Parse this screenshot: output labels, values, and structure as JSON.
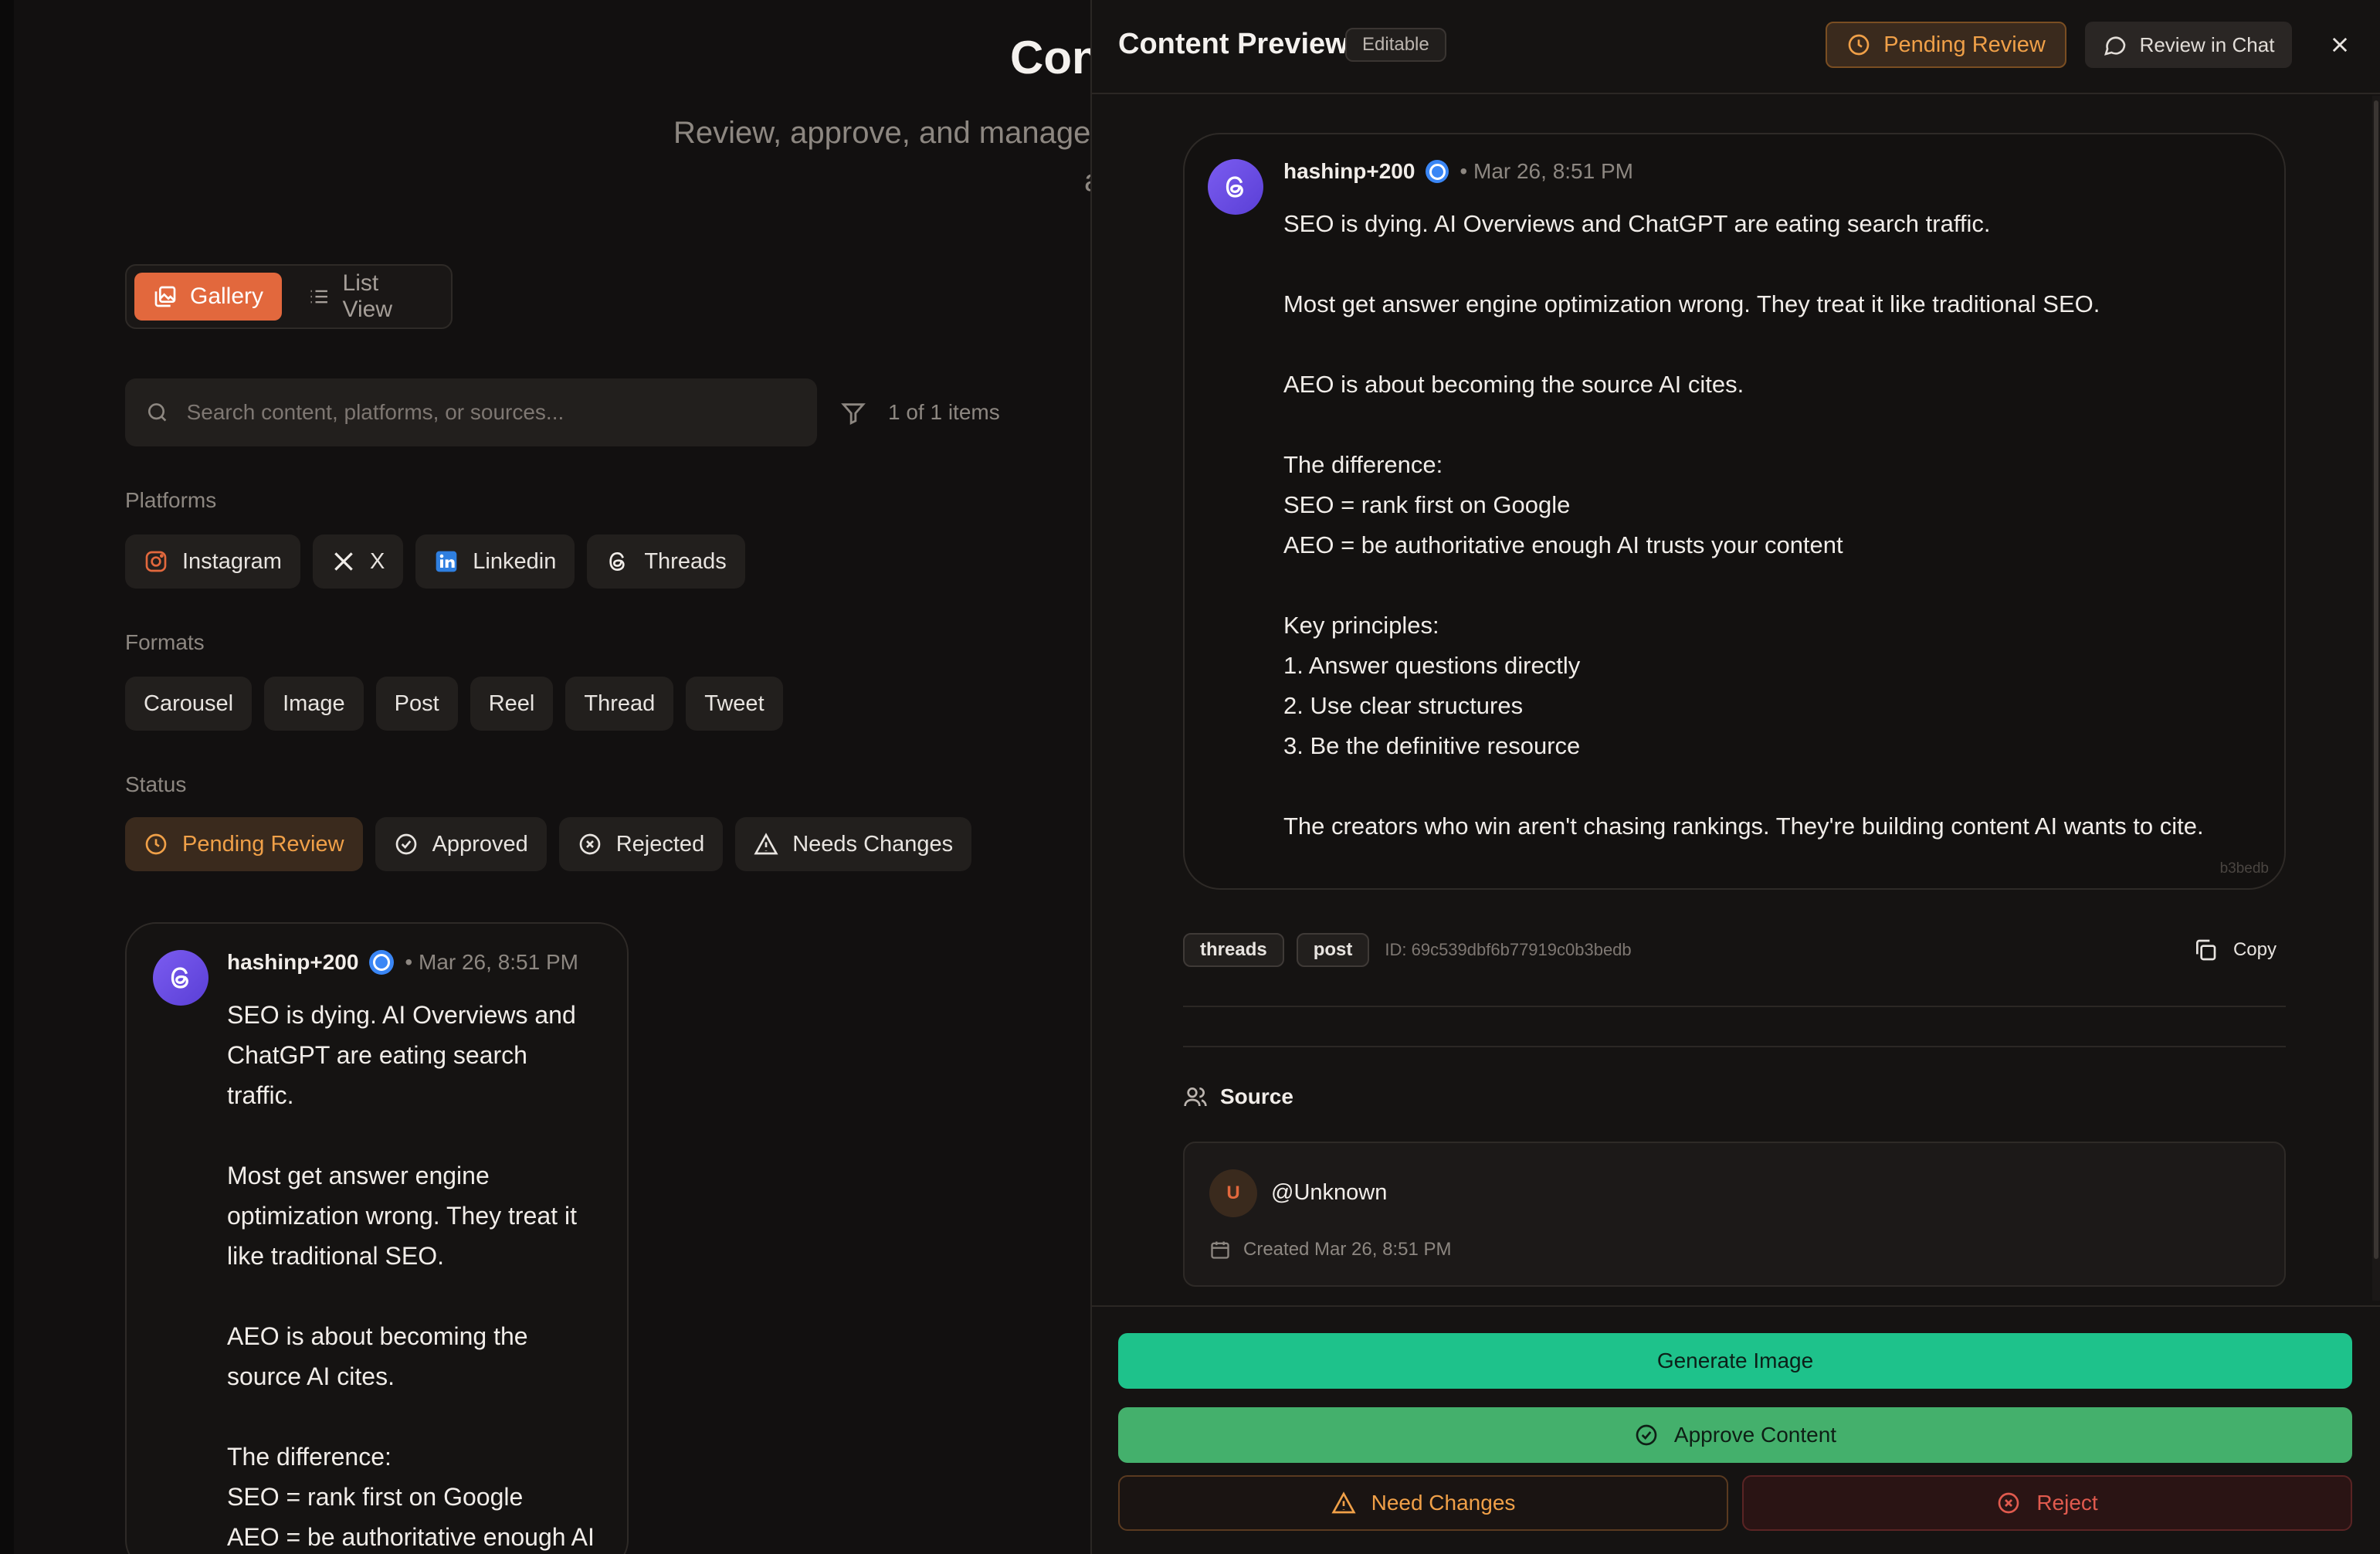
{
  "page": {
    "title": "Con",
    "subtitle": "Review, approve, and manage",
    "subtitle_cont": "a",
    "view_toggle": {
      "gallery": "Gallery",
      "list": "List View"
    },
    "search": {
      "placeholder": "Search content, platforms, or sources...",
      "value": ""
    },
    "item_count": "1 of 1 items",
    "platforms_label": "Platforms",
    "platforms": [
      "Instagram",
      "X",
      "Linkedin",
      "Threads"
    ],
    "formats_label": "Formats",
    "formats": [
      "Carousel",
      "Image",
      "Post",
      "Reel",
      "Thread",
      "Tweet"
    ],
    "status_label": "Status",
    "statuses": [
      "Pending Review",
      "Approved",
      "Rejected",
      "Needs Changes"
    ]
  },
  "post": {
    "username": "hashinp+200",
    "timestamp": "• Mar 26, 8:51 PM",
    "card_body": "SEO is dying. AI Overviews and\nChatGPT are eating search\ntraffic.\n\nMost get answer engine\noptimization wrong. They treat it\nlike traditional SEO.\n\nAEO is about becoming the\nsource AI cites.\n\nThe difference:\nSEO = rank first on Google\nAEO = be authoritative enough AI",
    "full_body": "SEO is dying. AI Overviews and ChatGPT are eating search traffic.\n\nMost get answer engine optimization wrong. They treat it like traditional SEO.\n\nAEO is about becoming the source AI cites.\n\nThe difference:\nSEO = rank first on Google\nAEO = be authoritative enough AI trusts your content\n\nKey principles:\n1. Answer questions directly\n2. Use clear structures\n3. Be the definitive resource\n\nThe creators who win aren't chasing rankings. They're building content AI wants to cite."
  },
  "drawer": {
    "title": "Content Preview",
    "editable_badge": "Editable",
    "status_button": "Pending Review",
    "chat_button": "Review in Chat",
    "card_tag": "b3bedb",
    "tags": [
      "threads",
      "post"
    ],
    "id_text": "ID: 69c539dbf6b77919c0b3bedb",
    "copy_label": "Copy",
    "source_heading": "Source",
    "source_avatar": "U",
    "source_handle": "@Unknown",
    "created": "Created Mar 26, 8:51 PM",
    "buttons": {
      "generate": "Generate Image",
      "approve": "Approve Content",
      "changes": "Need Changes",
      "reject": "Reject"
    }
  },
  "colors": {
    "accent": "#e2683d",
    "pending": "#f0a048",
    "generate": "#1ec28b",
    "approve": "#44b06c",
    "reject": "#e05a4e",
    "threads_avatar": "#6a4ee6",
    "verified": "#3a86f5"
  }
}
